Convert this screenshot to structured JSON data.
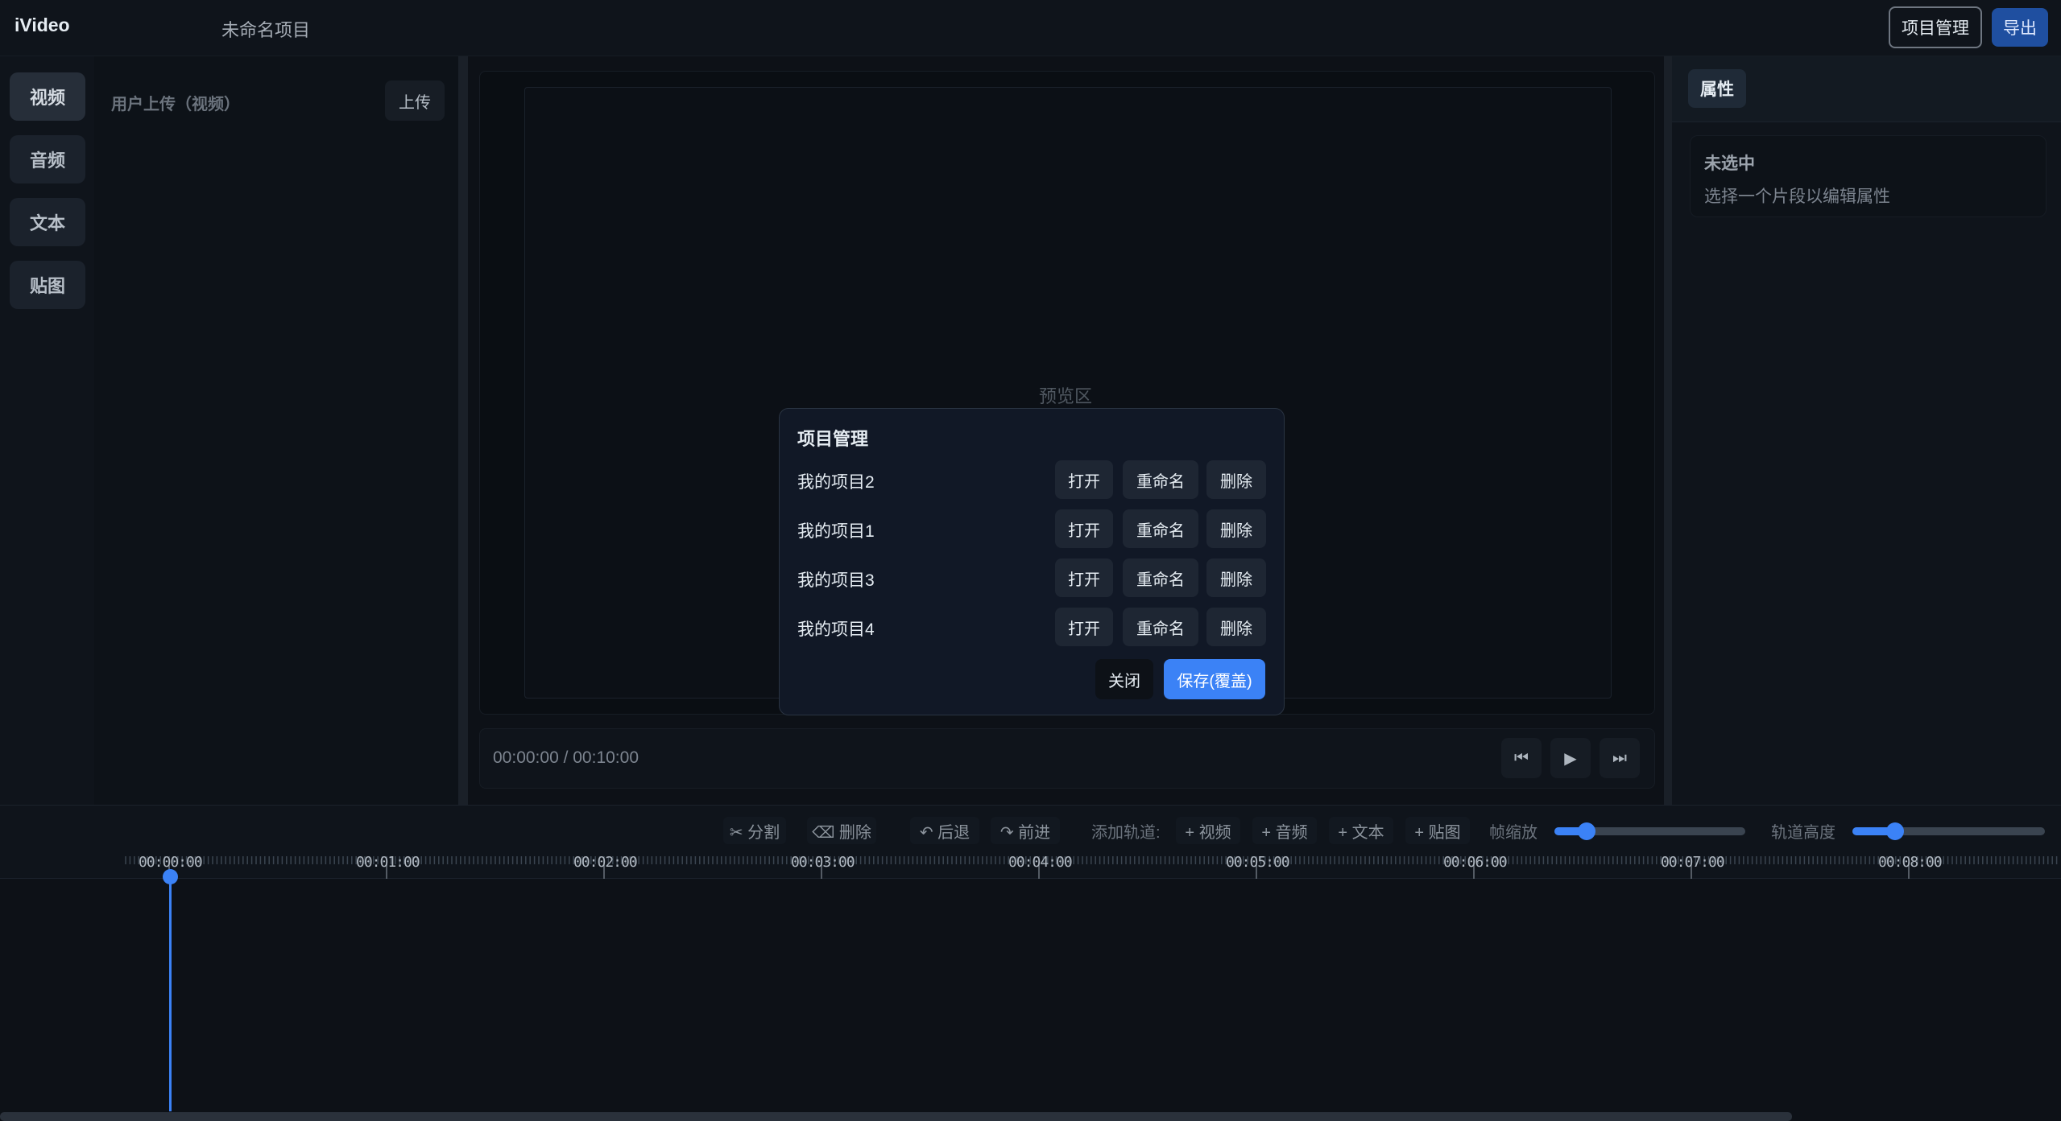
{
  "app": {
    "title": "iVideo",
    "project_name": "未命名项目"
  },
  "header": {
    "project_manage_label": "项目管理",
    "export_label": "导出"
  },
  "left_nav": {
    "items": [
      "视频",
      "音频",
      "文本",
      "贴图"
    ]
  },
  "media": {
    "title": "用户上传（视频）",
    "upload_label": "上传"
  },
  "preview": {
    "label": "预览区",
    "timecode": "00:00:00 / 00:10:00"
  },
  "transport": {
    "prev_icon": "⏮",
    "play_icon": "▶",
    "next_icon": "⏭"
  },
  "properties": {
    "tab_label": "属性",
    "empty_title": "未选中",
    "empty_desc": "选择一个片段以编辑属性"
  },
  "timeline": {
    "split": "✂ 分割",
    "delete": "⌫ 删除",
    "undo": "↶ 后退",
    "redo": "↷ 前进",
    "add_track_label": "添加轨道:",
    "add_video": "+ 视频",
    "add_audio": "+ 音频",
    "add_text": "+ 文本",
    "add_sticker": "+ 贴图",
    "zoom_label": "帧缩放",
    "zoom_value": 0.17,
    "track_height_label": "轨道高度",
    "track_height_value": 0.22,
    "ruler": [
      "00:00:00",
      "00:01:00",
      "00:02:00",
      "00:03:00",
      "00:04:00",
      "00:05:00",
      "00:06:00",
      "00:07:00",
      "00:08:00"
    ]
  },
  "modal": {
    "title": "项目管理",
    "projects": [
      {
        "name": "我的项目2",
        "open": "打开",
        "rename": "重命名",
        "delete": "删除"
      },
      {
        "name": "我的项目1",
        "open": "打开",
        "rename": "重命名",
        "delete": "删除"
      },
      {
        "name": "我的项目3",
        "open": "打开",
        "rename": "重命名",
        "delete": "删除"
      },
      {
        "name": "我的项目4",
        "open": "打开",
        "rename": "重命名",
        "delete": "删除"
      }
    ],
    "close_label": "关闭",
    "save_label": "保存(覆盖)"
  },
  "colors": {
    "accent": "#3b82f6",
    "background": "#0d1117",
    "modal_bg": "#111826"
  }
}
